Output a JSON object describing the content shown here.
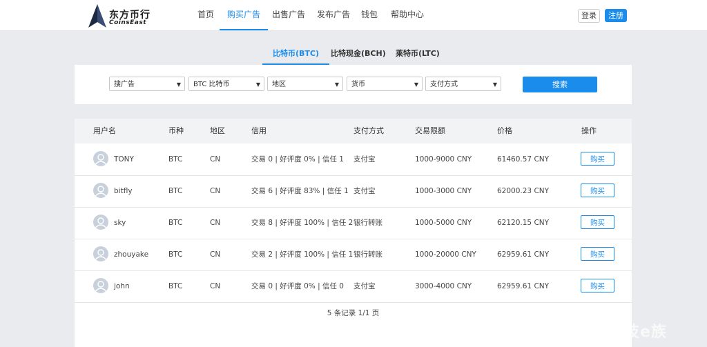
{
  "header": {
    "logo_cn": "东方币行",
    "logo_en": "CoinsEast",
    "nav": [
      {
        "label": "首页",
        "active": false
      },
      {
        "label": "购买广告",
        "active": true
      },
      {
        "label": "出售广告",
        "active": false
      },
      {
        "label": "发布广告",
        "active": false
      },
      {
        "label": "钱包",
        "active": false
      },
      {
        "label": "帮助中心",
        "active": false
      }
    ],
    "login_label": "登录",
    "register_label": "注册"
  },
  "coin_tabs": [
    {
      "label": "比特币(BTC)",
      "active": true
    },
    {
      "label": "比特现金(BCH)",
      "active": false
    },
    {
      "label": "莱特币(LTC)",
      "active": false
    }
  ],
  "search": {
    "selects": [
      "搜广告",
      "BTC 比特币",
      "地区",
      "货币",
      "支付方式"
    ],
    "button_label": "搜索"
  },
  "table": {
    "headers": [
      "用户名",
      "币种",
      "地区",
      "信用",
      "支付方式",
      "交易限额",
      "价格",
      "操作"
    ],
    "rows": [
      {
        "user": "TONY",
        "coin": "BTC",
        "region": "CN",
        "credit": "交易 0 | 好评度 0% | 信任 1",
        "payment": "支付宝",
        "limit": "1000-9000 CNY",
        "price": "61460.57 CNY",
        "action": "购买"
      },
      {
        "user": "bitfly",
        "coin": "BTC",
        "region": "CN",
        "credit": "交易 6 | 好评度 83% | 信任 1",
        "payment": "支付宝",
        "limit": "1000-3000 CNY",
        "price": "62000.23 CNY",
        "action": "购买"
      },
      {
        "user": "sky",
        "coin": "BTC",
        "region": "CN",
        "credit": "交易 8 | 好评度 100% | 信任 2",
        "payment": "银行转账",
        "limit": "1000-5000 CNY",
        "price": "62120.15 CNY",
        "action": "购买"
      },
      {
        "user": "zhouyake",
        "coin": "BTC",
        "region": "CN",
        "credit": "交易 2 | 好评度 100% | 信任 1",
        "payment": "银行转账",
        "limit": "1000-20000 CNY",
        "price": "62959.61 CNY",
        "action": "购买"
      },
      {
        "user": "john",
        "coin": "BTC",
        "region": "CN",
        "credit": "交易 0 | 好评度 0% | 信任 0",
        "payment": "支付宝",
        "limit": "3000-4000 CNY",
        "price": "62959.61 CNY",
        "action": "购买"
      }
    ],
    "pagination": "5 条记录 1/1 页"
  },
  "watermark": "技e族",
  "colors": {
    "accent": "#1a8cec",
    "background": "#e9ebee",
    "avatar": "#c8d0dc"
  }
}
